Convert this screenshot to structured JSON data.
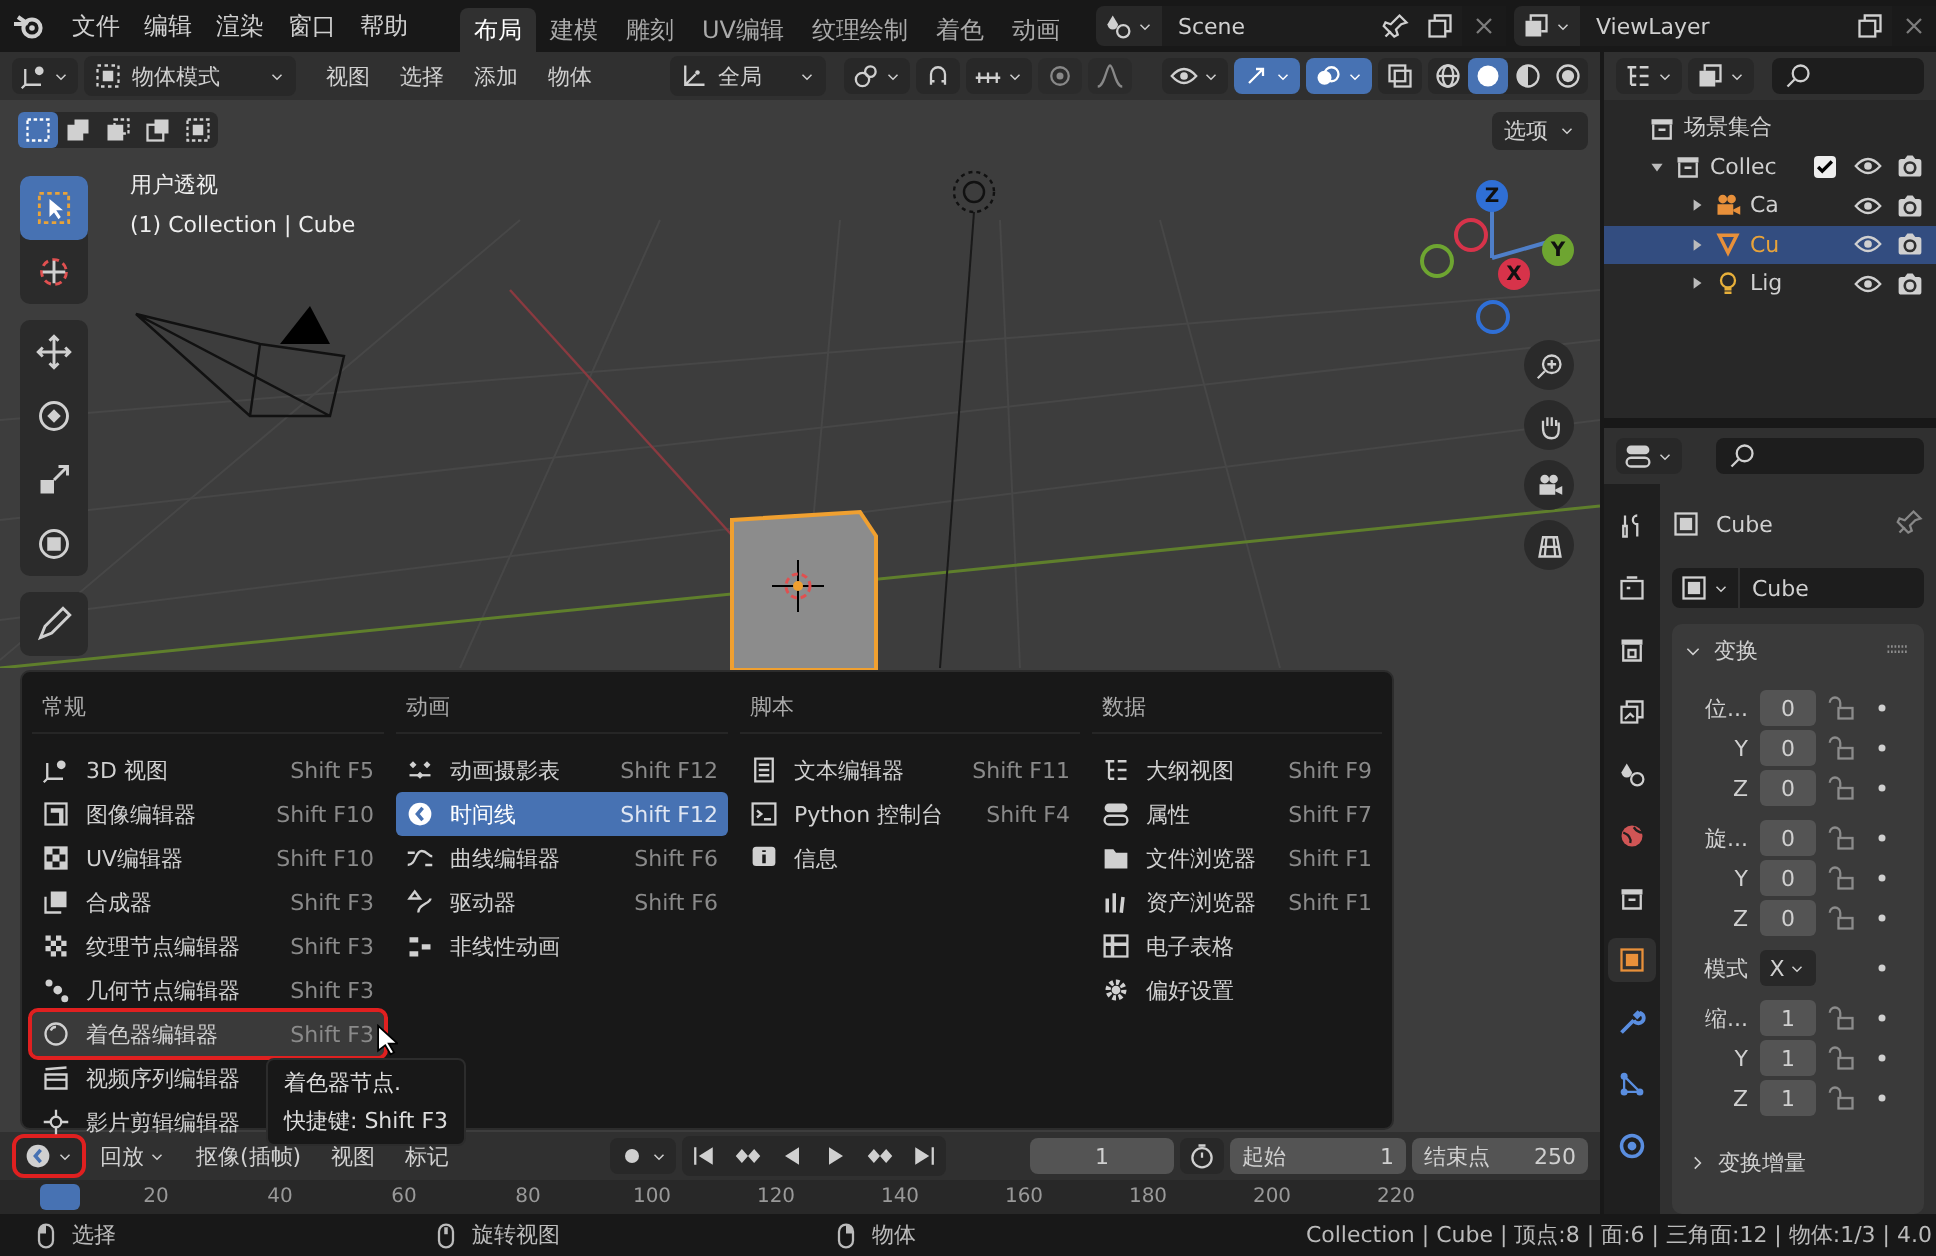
{
  "top_bar": {
    "menus": [
      "文件",
      "编辑",
      "渲染",
      "窗口",
      "帮助"
    ],
    "workspaces": [
      {
        "label": "布局",
        "selected": true
      },
      {
        "label": "建模",
        "selected": false
      },
      {
        "label": "雕刻",
        "selected": false
      },
      {
        "label": "UV编辑",
        "selected": false
      },
      {
        "label": "纹理绘制",
        "selected": false
      },
      {
        "label": "着色",
        "selected": false
      },
      {
        "label": "动画",
        "selected": false
      }
    ],
    "scene": "Scene",
    "view_layer": "ViewLayer"
  },
  "viewport_header": {
    "mode": "物体模式",
    "menus": [
      "视图",
      "选择",
      "添加",
      "物体"
    ],
    "orientation": "全局",
    "options": "选项",
    "gizmos_on": true,
    "overlays_on": true,
    "shading_modes": [
      {
        "kind": "wire",
        "selected": false
      },
      {
        "kind": "solid",
        "selected": true
      },
      {
        "kind": "material",
        "selected": false
      },
      {
        "kind": "rendered",
        "selected": false
      }
    ]
  },
  "viewport": {
    "view_name": "用户透视",
    "object_info": "(1) Collection | Cube",
    "select_modes": [
      {
        "kind": "sel_new",
        "selected": true
      },
      {
        "kind": "sel_add",
        "selected": false
      },
      {
        "kind": "sel_sub",
        "selected": false
      },
      {
        "kind": "sel_inv",
        "selected": false
      },
      {
        "kind": "sel_and",
        "selected": false
      }
    ],
    "tools": [
      {
        "kind": "select",
        "selected": true
      },
      {
        "kind": "cursor",
        "selected": false
      },
      {
        "kind": "move",
        "selected": false
      },
      {
        "kind": "rotate",
        "selected": false
      },
      {
        "kind": "scale",
        "selected": false
      },
      {
        "kind": "transform",
        "selected": false
      },
      {
        "kind": "annotate",
        "selected": false
      }
    ],
    "gizmo_axes": [
      "Z",
      "Y",
      "X"
    ]
  },
  "editor_menu": {
    "columns": [
      {
        "title": "常规",
        "items": [
          {
            "kind": "view3d",
            "label": "3D 视图",
            "shortcut": "Shift F5",
            "selected": false,
            "hovered": false
          },
          {
            "kind": "image",
            "label": "图像编辑器",
            "shortcut": "Shift F10",
            "selected": false,
            "hovered": false
          },
          {
            "kind": "uv",
            "label": "UV编辑器",
            "shortcut": "Shift F10",
            "selected": false,
            "hovered": false
          },
          {
            "kind": "compositor",
            "label": "合成器",
            "shortcut": "Shift F3",
            "selected": false,
            "hovered": false
          },
          {
            "kind": "texture",
            "label": "纹理节点编辑器",
            "shortcut": "Shift F3",
            "selected": false,
            "hovered": false
          },
          {
            "kind": "geometry",
            "label": "几何节点编辑器",
            "shortcut": "Shift F3",
            "selected": false,
            "hovered": false
          },
          {
            "kind": "shader",
            "label": "着色器编辑器",
            "shortcut": "Shift F3",
            "selected": false,
            "hovered": true
          },
          {
            "kind": "sequencer",
            "label": "视频序列编辑器",
            "selected": false,
            "hovered": false
          },
          {
            "kind": "clip",
            "label": "影片剪辑编辑器",
            "selected": false,
            "hovered": false
          }
        ]
      },
      {
        "title": "动画",
        "items": [
          {
            "kind": "dopesheet",
            "label": "动画摄影表",
            "shortcut": "Shift F12",
            "selected": false,
            "hovered": false
          },
          {
            "kind": "timeline",
            "label": "时间线",
            "shortcut": "Shift F12",
            "selected": true,
            "hovered": false
          },
          {
            "kind": "graph",
            "label": "曲线编辑器",
            "shortcut": "Shift F6",
            "selected": false,
            "hovered": false
          },
          {
            "kind": "drivers",
            "label": "驱动器",
            "shortcut": "Shift F6",
            "selected": false,
            "hovered": false
          },
          {
            "kind": "nla",
            "label": "非线性动画",
            "selected": false,
            "hovered": false
          }
        ]
      },
      {
        "title": "脚本",
        "items": [
          {
            "kind": "text",
            "label": "文本编辑器",
            "shortcut": "Shift F11",
            "selected": false,
            "hovered": false
          },
          {
            "kind": "console",
            "label": "Python 控制台",
            "shortcut": "Shift F4",
            "selected": false,
            "hovered": false
          },
          {
            "kind": "info",
            "label": "信息",
            "selected": false,
            "hovered": false
          }
        ]
      },
      {
        "title": "数据",
        "items": [
          {
            "kind": "outliner",
            "label": "大纲视图",
            "shortcut": "Shift F9",
            "selected": false,
            "hovered": false
          },
          {
            "kind": "properties",
            "label": "属性",
            "shortcut": "Shift F7",
            "selected": false,
            "hovered": false
          },
          {
            "kind": "file",
            "label": "文件浏览器",
            "shortcut": "Shift F1",
            "selected": false,
            "hovered": false
          },
          {
            "kind": "asset",
            "label": "资产浏览器",
            "shortcut": "Shift F1",
            "selected": false,
            "hovered": false
          },
          {
            "kind": "spreadsheet",
            "label": "电子表格",
            "selected": false,
            "hovered": false
          },
          {
            "kind": "preferences",
            "label": "偏好设置",
            "selected": false,
            "hovered": false
          }
        ]
      }
    ]
  },
  "tooltip": {
    "title": "着色器节点.",
    "shortcut": "快捷键: Shift F3"
  },
  "timeline": {
    "editor_outlined": true,
    "menus": [
      "回放",
      "抠像(插帧)",
      "视图",
      "标记"
    ],
    "current_frame": "1",
    "start_label": "起始",
    "start": "1",
    "end_label": "结束点",
    "end": "250",
    "ticks": [
      "20",
      "40",
      "60",
      "80",
      "100",
      "120",
      "140",
      "160",
      "180",
      "200",
      "220"
    ]
  },
  "outliner": {
    "root": "场景集合",
    "items": [
      {
        "kind": "collection",
        "name": "Collec",
        "expanded": true,
        "checked": true,
        "selected": false,
        "children": [
          {
            "kind": "camera",
            "name": "Ca",
            "expanded": false,
            "selected": false
          },
          {
            "kind": "mesh",
            "name": "Cu",
            "expanded": false,
            "selected": true
          },
          {
            "kind": "light",
            "name": "Lig",
            "expanded": false,
            "selected": false
          }
        ]
      }
    ]
  },
  "properties": {
    "tabs": [
      {
        "kind": "tool",
        "selected": false
      },
      {
        "kind": "render",
        "selected": false
      },
      {
        "kind": "output",
        "selected": false
      },
      {
        "kind": "view_layer",
        "selected": false
      },
      {
        "kind": "scene",
        "selected": false
      },
      {
        "kind": "world",
        "selected": false
      },
      {
        "kind": "collection",
        "selected": false
      },
      {
        "kind": "object",
        "selected": true
      },
      {
        "kind": "modifiers",
        "selected": false
      },
      {
        "kind": "particles",
        "selected": false
      },
      {
        "kind": "physics",
        "selected": false
      }
    ],
    "object_name": "Cube",
    "data_name": "Cube",
    "panel": {
      "title": "变换",
      "expanded": true,
      "groups": [
        [
          {
            "kind": "number",
            "label": "位...",
            "value": "0"
          },
          {
            "kind": "number",
            "label": "Y",
            "value": "0"
          },
          {
            "kind": "number",
            "label": "Z",
            "value": "0"
          }
        ],
        [
          {
            "kind": "number",
            "label": "旋...",
            "value": "0"
          },
          {
            "kind": "number",
            "label": "Y",
            "value": "0"
          },
          {
            "kind": "number",
            "label": "Z",
            "value": "0"
          }
        ],
        [
          {
            "kind": "dropdown",
            "label": "模式",
            "value": "X"
          }
        ],
        [
          {
            "kind": "number",
            "label": "缩...",
            "value": "1"
          },
          {
            "kind": "number",
            "label": "Y",
            "value": "1"
          },
          {
            "kind": "number",
            "label": "Z",
            "value": "1"
          }
        ]
      ]
    },
    "subpanel": {
      "title": "变换增量",
      "expanded": false
    }
  },
  "status_bar": {
    "hints": [
      {
        "kind": "left",
        "label": "选择"
      },
      {
        "kind": "middle",
        "label": "旋转视图"
      },
      {
        "kind": "right",
        "label": "物体"
      }
    ],
    "stats": "Collection | Cube | 顶点:8 | 面:6 | 三角面:12 | 物体:1/3 | 4.0"
  }
}
